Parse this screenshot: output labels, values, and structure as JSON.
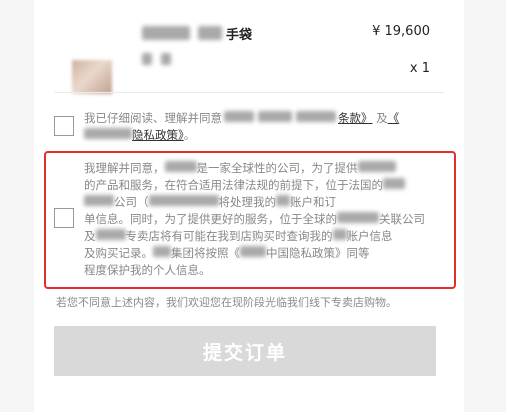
{
  "product": {
    "name_suffix": "手袋",
    "price": "¥ 19,600",
    "quantity": "x 1"
  },
  "consent1": {
    "text_pre": "我已仔细阅读、理解并同意",
    "terms_link": "条款》",
    "and": "及",
    "privacy_link_open": "《",
    "privacy_link": "隐私政策》",
    "end": "。"
  },
  "consent2": {
    "line1a": "我理解并同意，",
    "line1b": "是一家全球性的公司，为了提供",
    "line2": "的产品和服务，在符合适用法律法规的前提下，位于法国的",
    "line3a": "公司（",
    "line3b": "将处理我的",
    "line3c": "账户和订",
    "line4a": "单信息。同时，为了提供更好的服务，位于全球的",
    "line4b": "关联公",
    "line4c": "司",
    "line5a": "及",
    "line5b": "专卖店将有可能在我到店购买时查询我的",
    "line5c": "账户信息",
    "line6": "及购买记录。",
    "line6b": "集团将按照《",
    "line6c": "中国隐私政策》同等",
    "line7": "程度保护我的个人信息。"
  },
  "notice": "若您不同意上述内容，我们欢迎您在现阶段光临我们线下专卖店购物。",
  "submit_label": "提交订单"
}
